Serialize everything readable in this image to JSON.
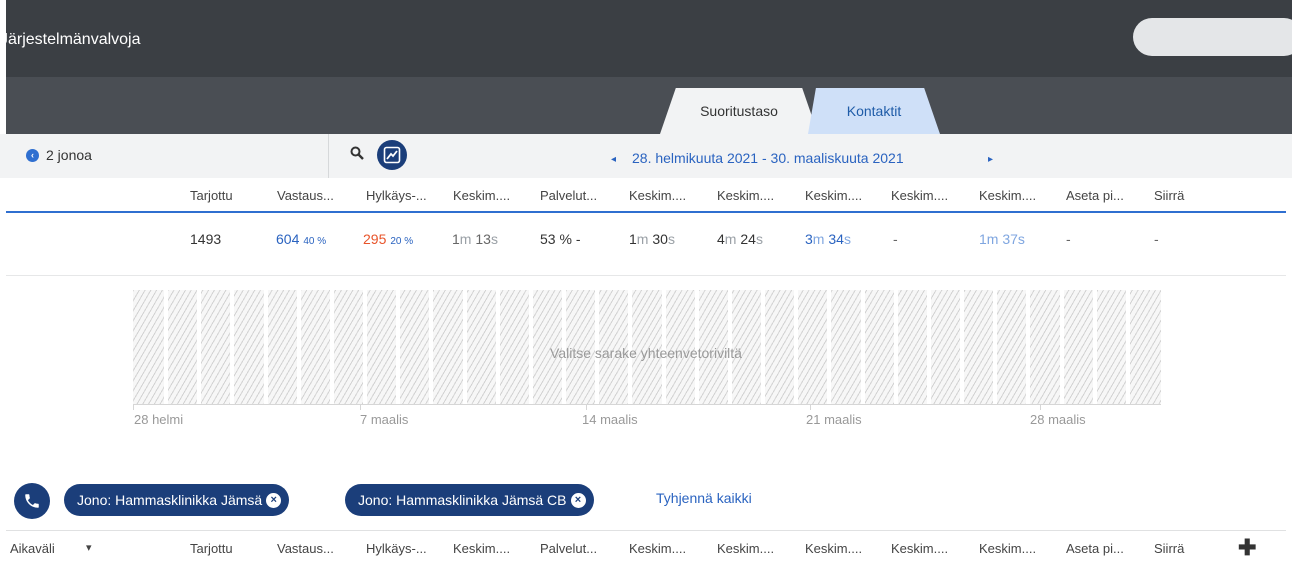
{
  "app": {
    "title": "Järjestelmänvalvoja"
  },
  "tabs": [
    {
      "label": "Suoritustaso"
    },
    {
      "label": "Kontaktit"
    }
  ],
  "toolbar": {
    "queues": "2 jonoa",
    "date_prev": "◂",
    "date_range": "28. helmikuuta 2021 - 30. maaliskuuta 2021",
    "date_next": "▸"
  },
  "columns": [
    "Tarjottu",
    "Vastaus...",
    "Hylkäys-...",
    "Keskim....",
    "Palvelut...",
    "Keskim....",
    "Keskim....",
    "Keskim....",
    "Keskim....",
    "Keskim....",
    "Aseta pi...",
    "Siirrä"
  ],
  "summary": {
    "offered": "1493",
    "answered": "604",
    "answered_pct": "40 %",
    "abandoned": "295",
    "abandoned_pct": "20 %",
    "c3_m": "1",
    "c3_m_unit": "m",
    "c3_s": "13",
    "c3_s_unit": "s",
    "service": "53 %",
    "service_trend": "-",
    "c5_m": "1",
    "c5_m_unit": "m",
    "c5_s": "30",
    "c5_s_unit": "s",
    "c6_m": "4",
    "c6_m_unit": "m",
    "c6_s": "24",
    "c6_s_unit": "s",
    "c7_m": "3",
    "c7_m_unit": "m",
    "c7_s": "34",
    "c7_s_unit": "s",
    "c8": "-",
    "c9": "1m 37s",
    "c10": "-",
    "c11": "-"
  },
  "chart": {
    "hint": "Valitse sarake yhteenvetoriviltä",
    "x_labels": [
      "28 helmi",
      "7 maalis",
      "14 maalis",
      "21 maalis",
      "28 maalis"
    ]
  },
  "filters": {
    "chips": [
      {
        "label": "Jono: Hammasklinikka Jämsä"
      },
      {
        "label": "Jono: Hammasklinikka Jämsä CB"
      }
    ],
    "clear_all": "Tyhjennä kaikki"
  },
  "bottom_table": {
    "first_column": "Aikaväli",
    "sort_icon": "▾",
    "add_icon": "✚"
  },
  "colors": {
    "topbar": "#3b3f44",
    "accent": "#2f6fd0",
    "chip": "#1b3e7a",
    "abandoned": "#e8542a"
  }
}
